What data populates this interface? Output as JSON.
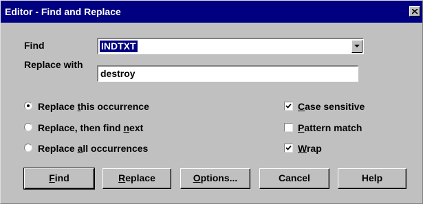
{
  "window": {
    "title": "Editor - Find and Replace"
  },
  "find": {
    "label": "Find",
    "value": "INDTXT"
  },
  "replace": {
    "label": "Replace with",
    "value": "destroy"
  },
  "radio_options": [
    {
      "pre": "Replace ",
      "key": "t",
      "post": "his occurrence",
      "selected": true
    },
    {
      "pre": "Replace, then find ",
      "key": "n",
      "post": "ext",
      "selected": false
    },
    {
      "pre": "Replace ",
      "key": "a",
      "post": "ll occurrences",
      "selected": false
    }
  ],
  "check_options": [
    {
      "pre": "",
      "key": "C",
      "post": "ase sensitive",
      "checked": true
    },
    {
      "pre": "",
      "key": "P",
      "post": "attern match",
      "checked": false
    },
    {
      "pre": "",
      "key": "W",
      "post": "rap",
      "checked": true
    }
  ],
  "buttons": {
    "find": {
      "pre": "",
      "key": "F",
      "post": "ind"
    },
    "replace": {
      "pre": "",
      "key": "R",
      "post": "eplace"
    },
    "options": {
      "pre": "",
      "key": "O",
      "post": "ptions..."
    },
    "cancel": {
      "pre": "Cancel",
      "key": "",
      "post": ""
    },
    "help": {
      "pre": "Help",
      "key": "",
      "post": ""
    }
  },
  "colors": {
    "titlebar": "#000080",
    "face": "#c0c0c0",
    "selection": "#000080"
  }
}
